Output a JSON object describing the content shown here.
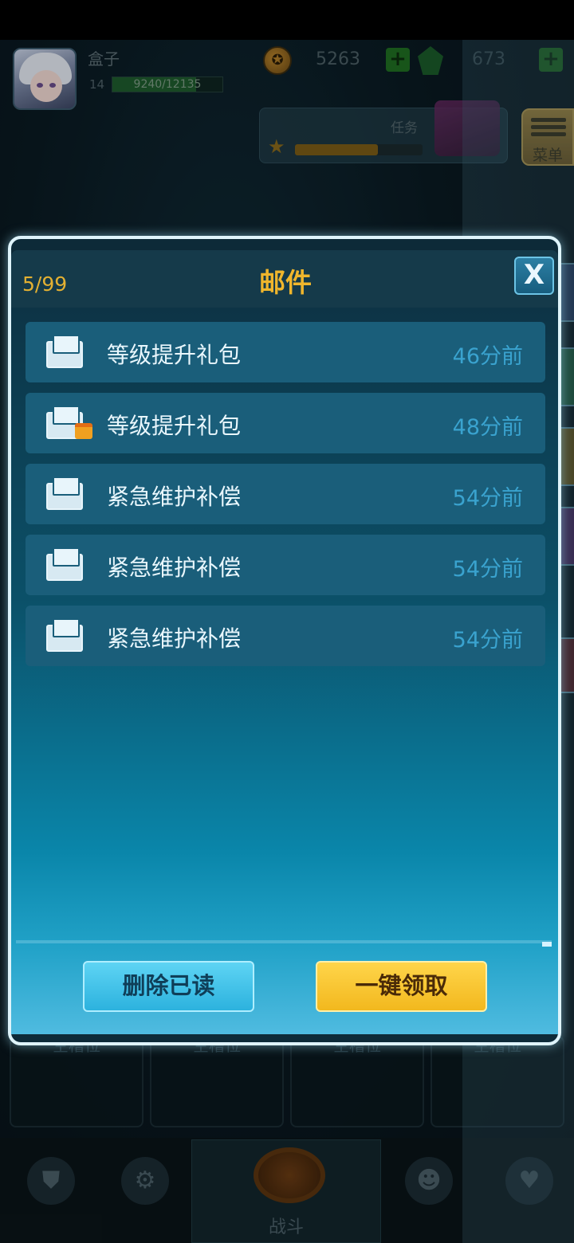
{
  "hud": {
    "player_name": "盒子",
    "level": "14",
    "exp_text": "9240/12135",
    "exp_progress": 0.76,
    "coins": "5263",
    "gems": "673",
    "task_label": "任务",
    "task_progress": 0.65,
    "menu_label": "菜单"
  },
  "background": {
    "slot_label": "空槽位",
    "battle_tab_label": "战斗"
  },
  "mail_dialog": {
    "title": "邮件",
    "count": "5/99",
    "close_label": "X",
    "items": [
      {
        "subject": "等级提升礼包",
        "time": "46分前",
        "has_gift": false
      },
      {
        "subject": "等级提升礼包",
        "time": "48分前",
        "has_gift": true
      },
      {
        "subject": "紧急维护补偿",
        "time": "54分前",
        "has_gift": false
      },
      {
        "subject": "紧急维护补偿",
        "time": "54分前",
        "has_gift": false
      },
      {
        "subject": "紧急维护补偿",
        "time": "54分前",
        "has_gift": false
      }
    ],
    "delete_read_label": "删除已读",
    "claim_all_label": "一键领取"
  },
  "colors": {
    "title_gold": "#f0b62c",
    "time_blue": "#3aa3cf",
    "claim_button": "#ffd54a",
    "delete_button": "#5ed4f4"
  }
}
